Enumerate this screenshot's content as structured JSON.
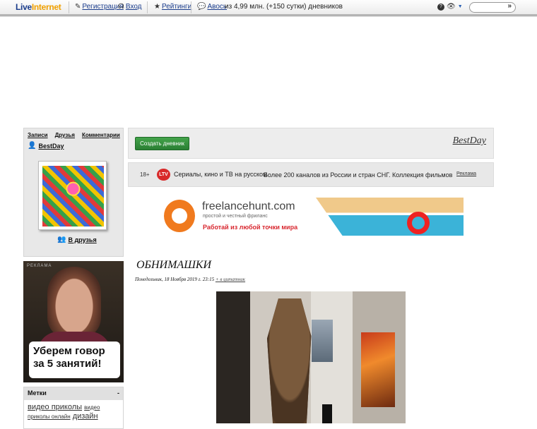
{
  "topbar": {
    "logo_part1": "Live",
    "logo_part2": "Internet",
    "register": "Регистрация",
    "login": "Вход",
    "ratings": "Рейтинги",
    "avos": "Авось",
    "stats": "из 4,99 млн. (+150 сутки) дневников",
    "search_go": "»"
  },
  "sidebar": {
    "nav": [
      "Записи",
      "Друзья",
      "Комментарии"
    ],
    "username": "BestDay",
    "add_friend": "В друзья",
    "ad": {
      "tag": "РЕКЛАМА",
      "text": "Уберем говор за 5 занятий!"
    },
    "tags": {
      "title": "Метки",
      "toggle": "-",
      "items": [
        {
          "label": "видео приколы",
          "size": "lg"
        },
        {
          "label": "видео приколы онлайн",
          "size": "sm"
        },
        {
          "label": "дизайн",
          "size": "lg"
        }
      ]
    }
  },
  "main": {
    "create_button": "Создать дневник",
    "blog_title": "BestDay",
    "promo": {
      "age": "18+",
      "logo": "LTV",
      "title": "Сериалы, кино и ТВ на русском",
      "desc": "Более 200 каналов из России и стран СНГ. Коллекция фильмов",
      "ad_label": "Реклама"
    },
    "banner": {
      "name": "freelancehunt.com",
      "subtitle": "простой и честный фриланс",
      "slogan": "Работай из любой точки мира"
    },
    "post": {
      "title": "ОБНИМАШКИ",
      "date": "Понедельник, 18 Ноября 2019 г. 23:15",
      "quote_link": "+ в цитатник"
    }
  },
  "colors": {
    "link": "#1a3c8c",
    "create_button": "#2a7f33",
    "banner_accent": "#f07a1e",
    "slogan": "#d8262e"
  }
}
